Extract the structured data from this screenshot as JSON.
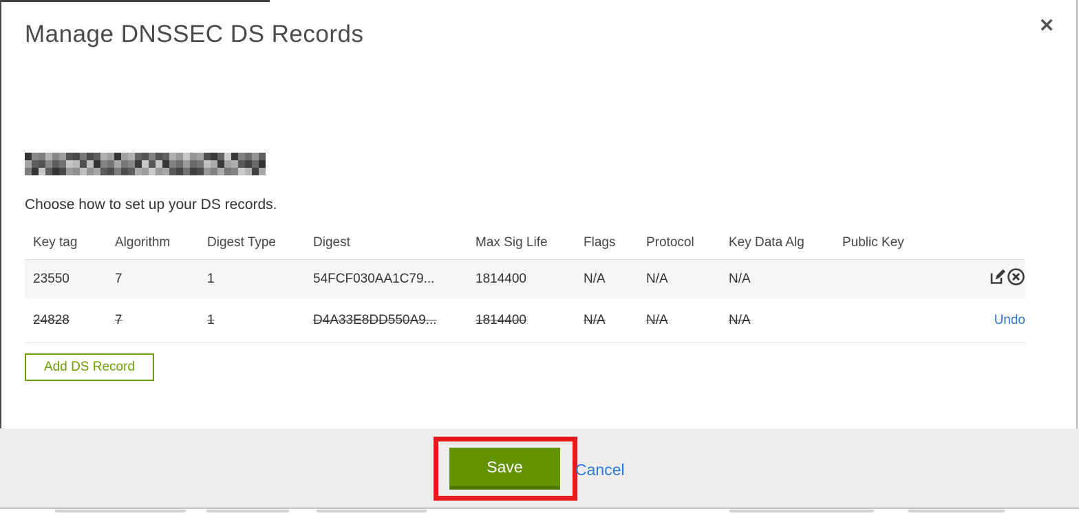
{
  "dialog": {
    "title": "Manage DNSSEC DS Records",
    "close_icon": "✕",
    "intro": "Choose how to set up your DS records.",
    "table": {
      "columns": [
        "Key tag",
        "Algorithm",
        "Digest Type",
        "Digest",
        "Max Sig Life",
        "Flags",
        "Protocol",
        "Key Data Alg",
        "Public Key"
      ],
      "rows": [
        {
          "key_tag": "23550",
          "algorithm": "7",
          "digest_type": "1",
          "digest": "54FCF030AA1C79...",
          "max_sig_life": "1814400",
          "flags": "N/A",
          "protocol": "N/A",
          "key_data_alg": "N/A",
          "public_key": "",
          "status": "active"
        },
        {
          "key_tag": "24828",
          "algorithm": "7",
          "digest_type": "1",
          "digest": "D4A33E8DD550A9...",
          "max_sig_life": "1814400",
          "flags": "N/A",
          "protocol": "N/A",
          "key_data_alg": "N/A",
          "public_key": "",
          "status": "marked-for-deletion",
          "undo_label": "Undo"
        }
      ]
    },
    "add_ds_record_label": "Add DS Record",
    "footer": {
      "save_label": "Save",
      "cancel_label": "Cancel"
    },
    "colors": {
      "accent_green": "#6b9e00",
      "save_button_green": "#619400",
      "save_button_green_dark": "#4c7a02",
      "link_blue": "#2d79d6",
      "annotation_red": "#e8191d",
      "footer_gray": "#eeedec",
      "row_gray": "#f6f6f6"
    }
  }
}
